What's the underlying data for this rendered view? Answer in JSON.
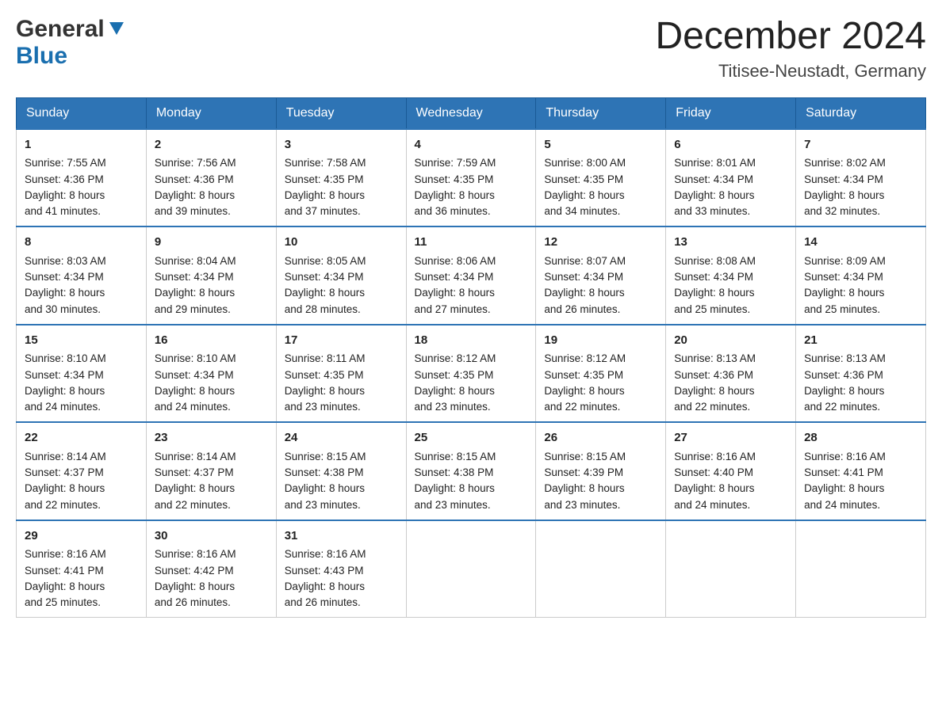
{
  "header": {
    "logo_general": "General",
    "logo_blue": "Blue",
    "month_title": "December 2024",
    "location": "Titisee-Neustadt, Germany"
  },
  "days_of_week": [
    "Sunday",
    "Monday",
    "Tuesday",
    "Wednesday",
    "Thursday",
    "Friday",
    "Saturday"
  ],
  "weeks": [
    [
      {
        "day": "1",
        "sunrise": "7:55 AM",
        "sunset": "4:36 PM",
        "daylight": "8 hours and 41 minutes."
      },
      {
        "day": "2",
        "sunrise": "7:56 AM",
        "sunset": "4:36 PM",
        "daylight": "8 hours and 39 minutes."
      },
      {
        "day": "3",
        "sunrise": "7:58 AM",
        "sunset": "4:35 PM",
        "daylight": "8 hours and 37 minutes."
      },
      {
        "day": "4",
        "sunrise": "7:59 AM",
        "sunset": "4:35 PM",
        "daylight": "8 hours and 36 minutes."
      },
      {
        "day": "5",
        "sunrise": "8:00 AM",
        "sunset": "4:35 PM",
        "daylight": "8 hours and 34 minutes."
      },
      {
        "day": "6",
        "sunrise": "8:01 AM",
        "sunset": "4:34 PM",
        "daylight": "8 hours and 33 minutes."
      },
      {
        "day": "7",
        "sunrise": "8:02 AM",
        "sunset": "4:34 PM",
        "daylight": "8 hours and 32 minutes."
      }
    ],
    [
      {
        "day": "8",
        "sunrise": "8:03 AM",
        "sunset": "4:34 PM",
        "daylight": "8 hours and 30 minutes."
      },
      {
        "day": "9",
        "sunrise": "8:04 AM",
        "sunset": "4:34 PM",
        "daylight": "8 hours and 29 minutes."
      },
      {
        "day": "10",
        "sunrise": "8:05 AM",
        "sunset": "4:34 PM",
        "daylight": "8 hours and 28 minutes."
      },
      {
        "day": "11",
        "sunrise": "8:06 AM",
        "sunset": "4:34 PM",
        "daylight": "8 hours and 27 minutes."
      },
      {
        "day": "12",
        "sunrise": "8:07 AM",
        "sunset": "4:34 PM",
        "daylight": "8 hours and 26 minutes."
      },
      {
        "day": "13",
        "sunrise": "8:08 AM",
        "sunset": "4:34 PM",
        "daylight": "8 hours and 25 minutes."
      },
      {
        "day": "14",
        "sunrise": "8:09 AM",
        "sunset": "4:34 PM",
        "daylight": "8 hours and 25 minutes."
      }
    ],
    [
      {
        "day": "15",
        "sunrise": "8:10 AM",
        "sunset": "4:34 PM",
        "daylight": "8 hours and 24 minutes."
      },
      {
        "day": "16",
        "sunrise": "8:10 AM",
        "sunset": "4:34 PM",
        "daylight": "8 hours and 24 minutes."
      },
      {
        "day": "17",
        "sunrise": "8:11 AM",
        "sunset": "4:35 PM",
        "daylight": "8 hours and 23 minutes."
      },
      {
        "day": "18",
        "sunrise": "8:12 AM",
        "sunset": "4:35 PM",
        "daylight": "8 hours and 23 minutes."
      },
      {
        "day": "19",
        "sunrise": "8:12 AM",
        "sunset": "4:35 PM",
        "daylight": "8 hours and 22 minutes."
      },
      {
        "day": "20",
        "sunrise": "8:13 AM",
        "sunset": "4:36 PM",
        "daylight": "8 hours and 22 minutes."
      },
      {
        "day": "21",
        "sunrise": "8:13 AM",
        "sunset": "4:36 PM",
        "daylight": "8 hours and 22 minutes."
      }
    ],
    [
      {
        "day": "22",
        "sunrise": "8:14 AM",
        "sunset": "4:37 PM",
        "daylight": "8 hours and 22 minutes."
      },
      {
        "day": "23",
        "sunrise": "8:14 AM",
        "sunset": "4:37 PM",
        "daylight": "8 hours and 22 minutes."
      },
      {
        "day": "24",
        "sunrise": "8:15 AM",
        "sunset": "4:38 PM",
        "daylight": "8 hours and 23 minutes."
      },
      {
        "day": "25",
        "sunrise": "8:15 AM",
        "sunset": "4:38 PM",
        "daylight": "8 hours and 23 minutes."
      },
      {
        "day": "26",
        "sunrise": "8:15 AM",
        "sunset": "4:39 PM",
        "daylight": "8 hours and 23 minutes."
      },
      {
        "day": "27",
        "sunrise": "8:16 AM",
        "sunset": "4:40 PM",
        "daylight": "8 hours and 24 minutes."
      },
      {
        "day": "28",
        "sunrise": "8:16 AM",
        "sunset": "4:41 PM",
        "daylight": "8 hours and 24 minutes."
      }
    ],
    [
      {
        "day": "29",
        "sunrise": "8:16 AM",
        "sunset": "4:41 PM",
        "daylight": "8 hours and 25 minutes."
      },
      {
        "day": "30",
        "sunrise": "8:16 AM",
        "sunset": "4:42 PM",
        "daylight": "8 hours and 26 minutes."
      },
      {
        "day": "31",
        "sunrise": "8:16 AM",
        "sunset": "4:43 PM",
        "daylight": "8 hours and 26 minutes."
      },
      null,
      null,
      null,
      null
    ]
  ],
  "labels": {
    "sunrise": "Sunrise:",
    "sunset": "Sunset:",
    "daylight": "Daylight:"
  }
}
